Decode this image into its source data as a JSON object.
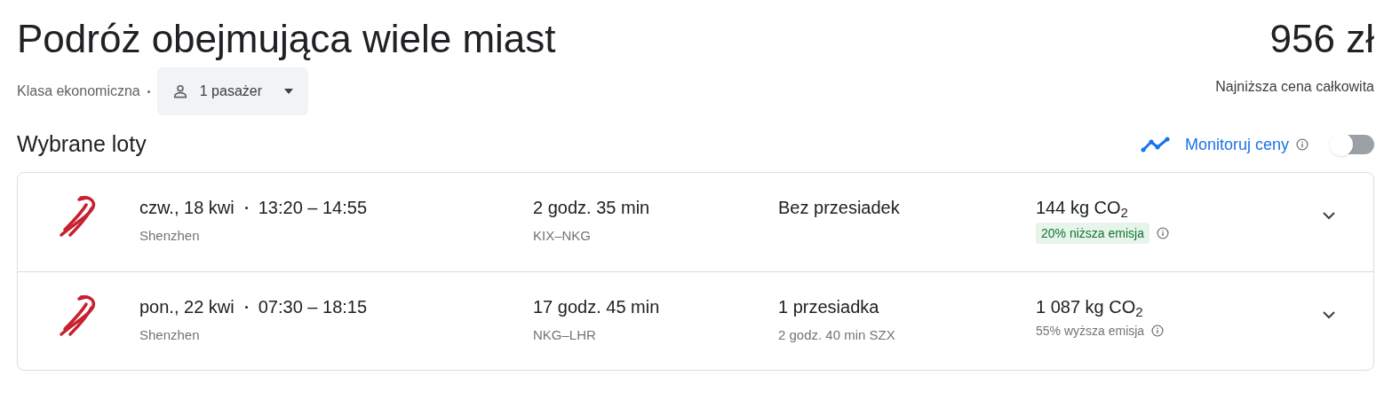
{
  "header": {
    "title": "Podróż obejmująca wiele miast",
    "cabin_class": "Klasa ekonomiczna",
    "passengers": "1 pasażer",
    "price": "956 zł",
    "price_note": "Najniższa cena całkowita"
  },
  "section": {
    "title": "Wybrane loty",
    "track_prices": {
      "label": "Monitoruj ceny",
      "on": false
    }
  },
  "flights": [
    {
      "date": "czw., 18 kwi",
      "times": "13:20 – 14:55",
      "airline": "Shenzhen",
      "duration": "2 godz. 35 min",
      "route": "KIX–NKG",
      "stops": "Bez przesiadek",
      "emissions": "144 kg CO$_{2}$",
      "emission_note": {
        "text": "20% niższa emisja",
        "kind": "lower"
      }
    },
    {
      "date": "pon., 22 kwi",
      "times": "07:30 – 18:15",
      "airline": "Shenzhen",
      "duration": "17 godz. 45 min",
      "route": "NKG–LHR",
      "stops": "1 przesiadka",
      "layover": "2 godz. 40 min SZX",
      "emissions": "1 087 kg CO$_{2}$",
      "emission_note": {
        "text": "55% wyższa emisja",
        "kind": "higher"
      }
    }
  ]
}
